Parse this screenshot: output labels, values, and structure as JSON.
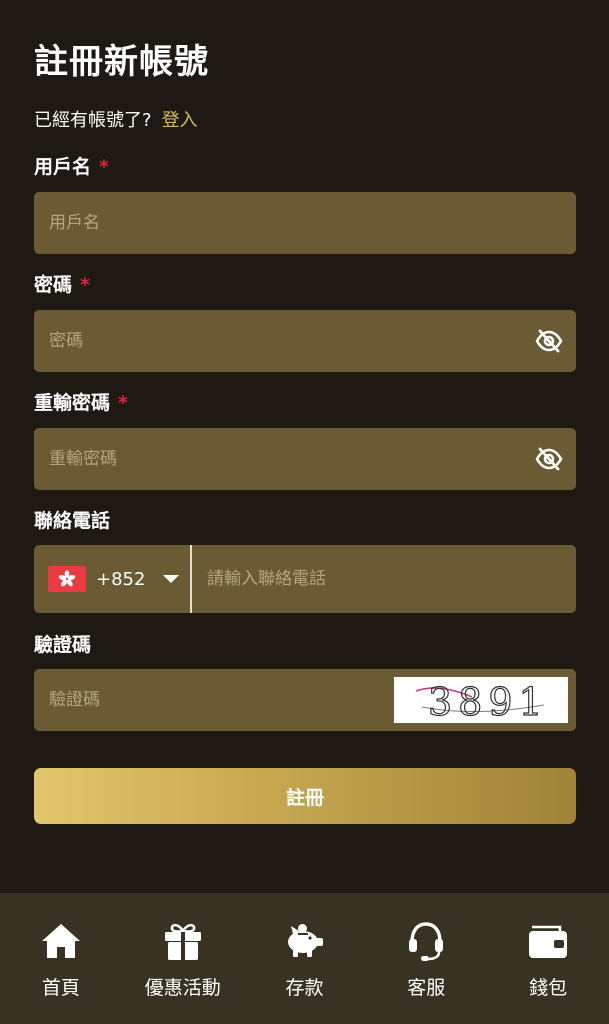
{
  "header": {
    "title": "註冊新帳號",
    "have_account_text": "已經有帳號了?",
    "login_link": "登入"
  },
  "form": {
    "username": {
      "label": "用戶名",
      "required_mark": "*",
      "placeholder": "用戶名",
      "value": ""
    },
    "password": {
      "label": "密碼",
      "required_mark": "*",
      "placeholder": "密碼",
      "value": "",
      "toggle_icon": "eye-off-icon"
    },
    "confirm_password": {
      "label": "重輸密碼",
      "required_mark": "*",
      "placeholder": "重輸密碼",
      "value": "",
      "toggle_icon": "eye-off-icon"
    },
    "phone": {
      "label": "聯絡電話",
      "country_code": "+852",
      "country_flag": "hong-kong-flag-icon",
      "placeholder": "請輸入聯絡電話",
      "value": ""
    },
    "captcha": {
      "label": "驗證碼",
      "placeholder": "驗證碼",
      "value": "",
      "image_text": "3891"
    },
    "submit_label": "註冊"
  },
  "bottom_nav": {
    "items": [
      {
        "label": "首頁",
        "icon": "home-icon"
      },
      {
        "label": "優惠活動",
        "icon": "gift-icon"
      },
      {
        "label": "存款",
        "icon": "piggy-bank-icon"
      },
      {
        "label": "客服",
        "icon": "headset-icon"
      },
      {
        "label": "錢包",
        "icon": "wallet-icon"
      }
    ]
  },
  "colors": {
    "background": "#1e1912",
    "field": "#6a5b34",
    "accent_gold": "#d9b95e",
    "required_red": "#e0253d",
    "nav_bar": "#373222"
  }
}
